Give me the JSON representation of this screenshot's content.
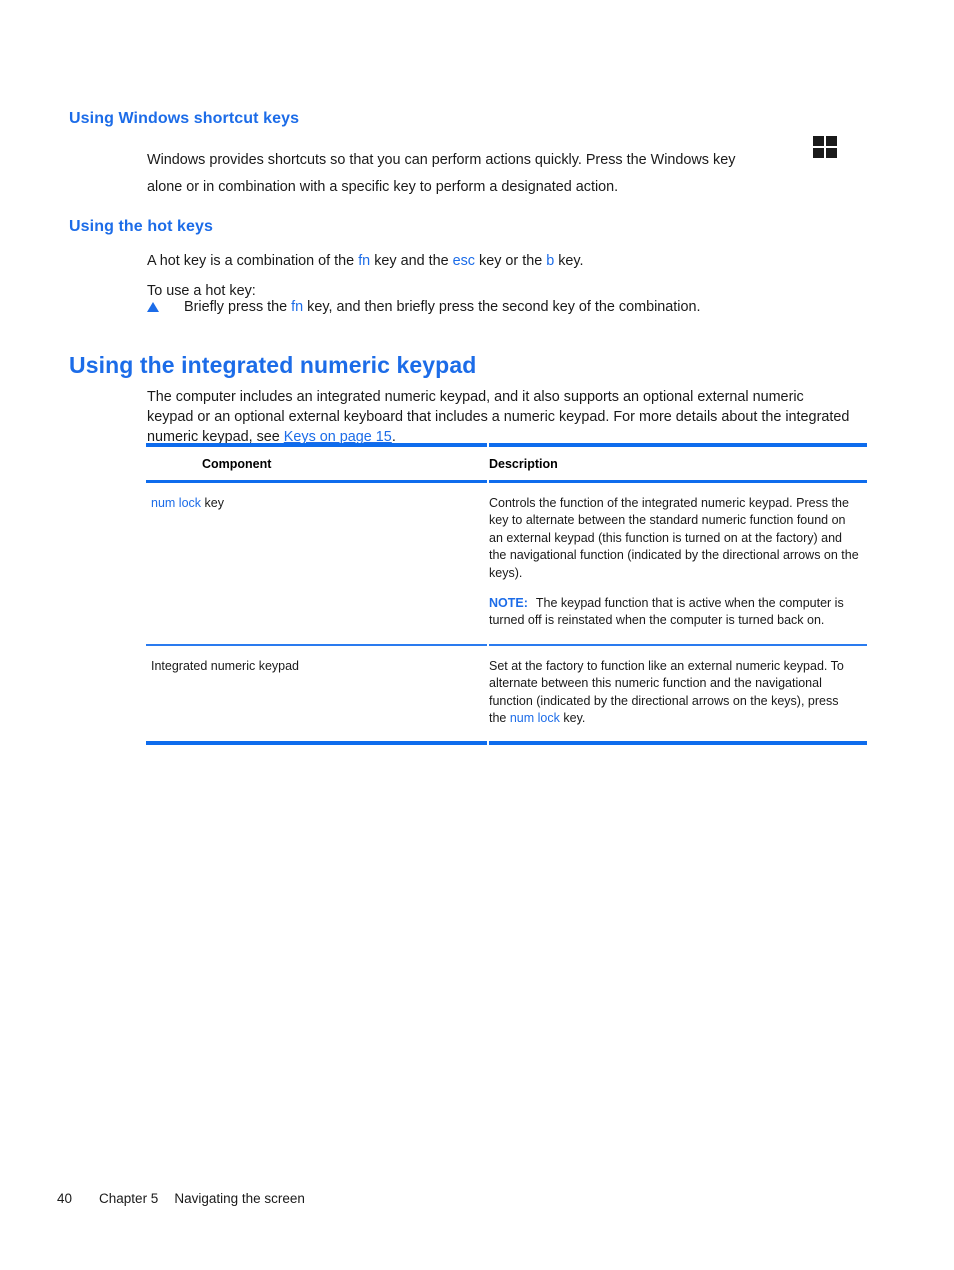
{
  "sections": {
    "windows_shortcut": {
      "heading": "Using Windows shortcut keys",
      "paragraph_before_icon": "Windows provides shortcuts so that you can perform actions quickly. Press the Windows key",
      "paragraph_after_icon": "alone or in combination with a specific key to perform a designated action.",
      "icon_name": "windows-logo-icon"
    },
    "hot_keys": {
      "heading": "Using the hot keys",
      "line1_part1": "A hot key is a combination of the ",
      "line1_key1": "fn",
      "line1_part2": " key and the ",
      "line1_key2": "esc",
      "line1_part3": " key or the ",
      "line1_key3": "b",
      "line1_part4": " key.",
      "line2": "To use a hot key:",
      "bullet_part1": "Briefly press the ",
      "bullet_key": "fn",
      "bullet_part2": " key, and then briefly press the second key of the combination."
    },
    "numeric_keypad": {
      "heading": "Using the integrated numeric keypad",
      "paragraph_part1": "The computer includes an integrated numeric keypad, and it also supports an optional external numeric keypad or an optional external keyboard that includes a numeric keypad. For more details about the integrated numeric keypad, see ",
      "paragraph_link": "Keys on page 15",
      "paragraph_part2": "."
    }
  },
  "table": {
    "headers": {
      "component": "Component",
      "description": "Description"
    },
    "rows": [
      {
        "component_key": "num lock",
        "component_suffix": " key",
        "description": "Controls the function of the integrated numeric keypad. Press the key to alternate between the standard numeric function found on an external keypad (this function is turned on at the factory) and the navigational function (indicated by the directional arrows on the keys).",
        "note_label": "NOTE:",
        "note_text": "The keypad function that is active when the computer is turned off is reinstated when the computer is turned back on."
      },
      {
        "component_plain": "Integrated numeric keypad",
        "description_part1": "Set at the factory to function like an external numeric keypad. To alternate between this numeric function and the navigational function (indicated by the directional arrows on the keys), press the ",
        "description_key": "num lock",
        "description_part2": " key."
      }
    ]
  },
  "footer": {
    "page_number": "40",
    "chapter": "Chapter 5",
    "chapter_title": "Navigating the screen"
  },
  "colors": {
    "heading_blue": "#1c6ce8",
    "rule_blue": "#0e6ced",
    "link_blue": "#1c6ce8",
    "body_black": "#1a1a1a"
  }
}
